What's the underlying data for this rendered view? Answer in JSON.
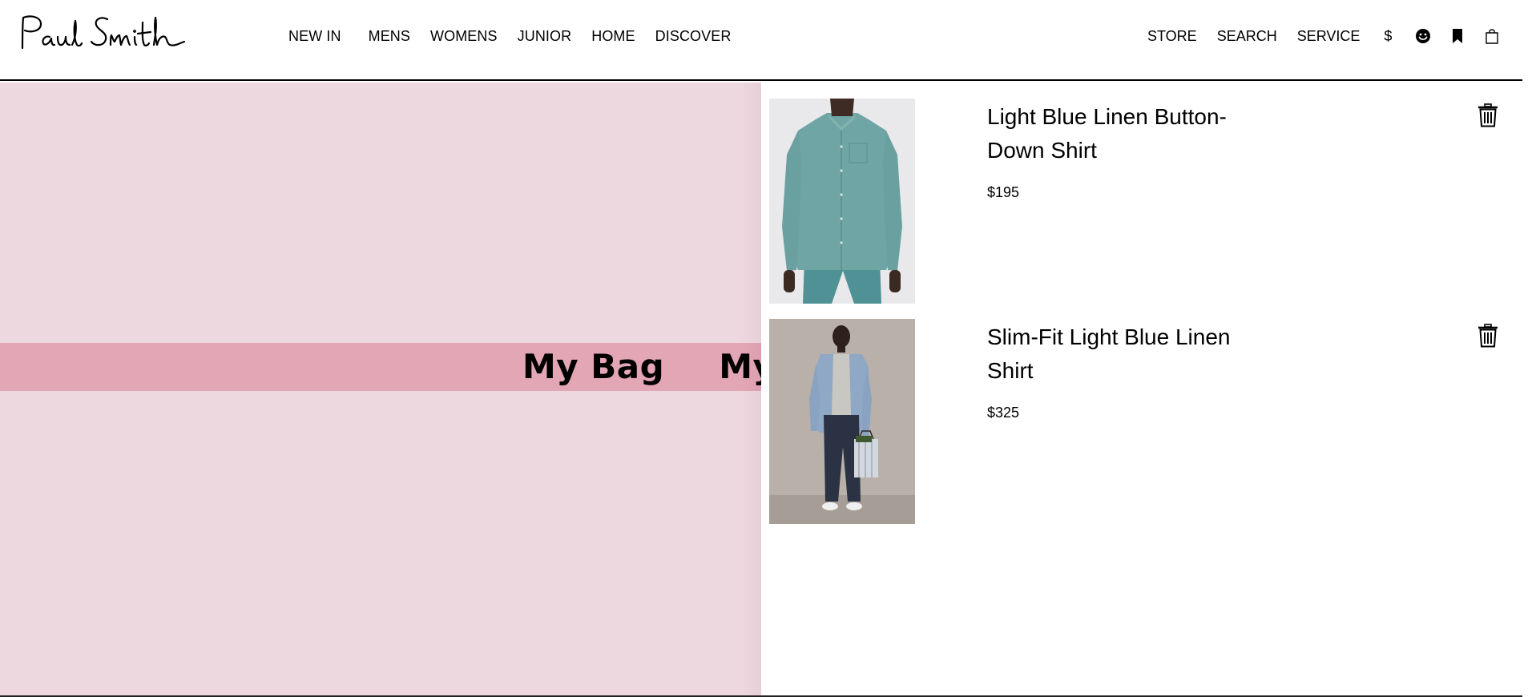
{
  "brand": {
    "logo_text": "Paul Smith"
  },
  "nav": {
    "items": [
      {
        "label": "NEW IN"
      },
      {
        "label": "MENS"
      },
      {
        "label": "WOMENS"
      },
      {
        "label": "JUNIOR"
      },
      {
        "label": "HOME"
      },
      {
        "label": "DISCOVER"
      }
    ]
  },
  "utility": {
    "store_label": "STORE",
    "search_label": "SEARCH",
    "service_label": "SERVICE",
    "currency_label": "$",
    "icons": [
      "account-icon",
      "bookmark-icon",
      "bag-icon"
    ]
  },
  "overlay": {
    "marquee_text": "My Bag",
    "marquee_repeat": [
      "My Bag",
      "My Bag"
    ]
  },
  "bag": {
    "items": [
      {
        "name": "Light Blue Linen Button-Down Shirt",
        "price": "$195",
        "image": "teal-linen-shirt-photo"
      },
      {
        "name": "Slim-Fit Light Blue Linen Shirt",
        "price": "$325",
        "image": "model-light-blue-shirt-photo"
      }
    ]
  },
  "colors": {
    "overlay_bg": "#eed8df",
    "marquee_bg": "#e3a6b5",
    "text": "#000000"
  }
}
